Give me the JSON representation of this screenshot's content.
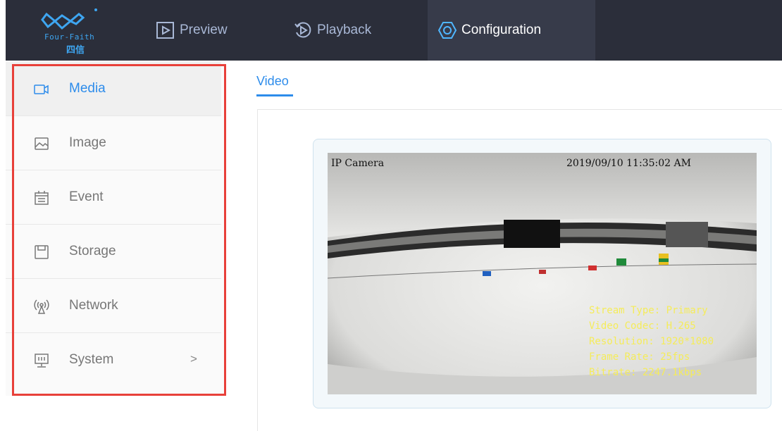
{
  "logo": {
    "text": "Four-Faith",
    "cn_text": "四信"
  },
  "nav": {
    "tabs": [
      {
        "label": "Preview",
        "icon": "play-square-icon"
      },
      {
        "label": "Playback",
        "icon": "playback-circle-icon"
      },
      {
        "label": "Configuration",
        "icon": "config-hexagon-icon"
      }
    ],
    "active": "Configuration"
  },
  "sidebar": {
    "items": [
      {
        "label": "Media",
        "icon": "video-camera-icon"
      },
      {
        "label": "Image",
        "icon": "image-icon"
      },
      {
        "label": "Event",
        "icon": "calendar-icon"
      },
      {
        "label": "Storage",
        "icon": "storage-icon"
      },
      {
        "label": "Network",
        "icon": "antenna-icon"
      },
      {
        "label": "System",
        "icon": "monitor-icon",
        "chevron": ">"
      }
    ],
    "active": "Media"
  },
  "content": {
    "tab_label": "Video"
  },
  "video": {
    "osd_title": "IP Camera",
    "osd_timestamp": "2019/09/10 11:35:02 AM",
    "stats": [
      "Stream Type: Primary",
      "Video Codec: H.265",
      "Resolution: 1920*1080",
      "Frame Rate: 25fps",
      "Bitrate: 2247.1kbps"
    ]
  },
  "colors": {
    "accent": "#2d8ceb",
    "nav_bg": "#2b2e3a",
    "highlight_border": "#e8403a",
    "osd_stats": "#f5ec5a"
  }
}
